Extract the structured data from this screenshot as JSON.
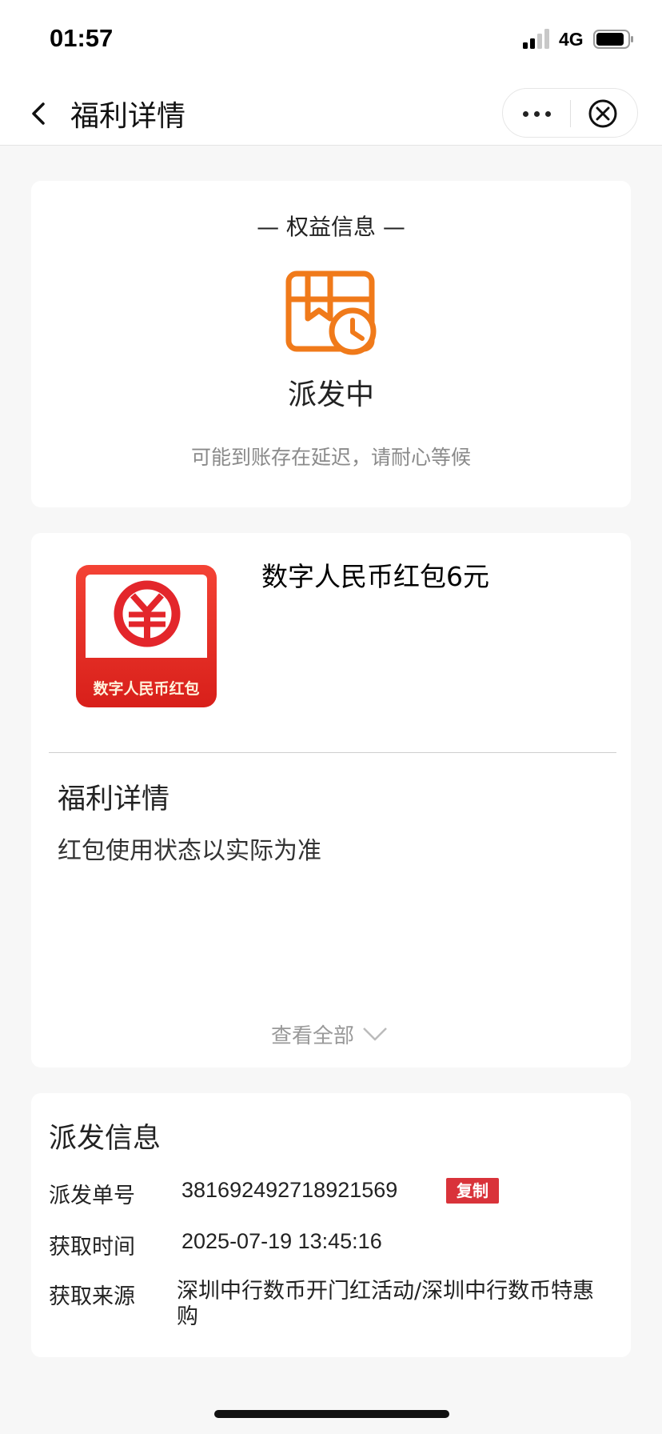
{
  "status_bar": {
    "time": "01:57",
    "network": "4G"
  },
  "nav": {
    "title": "福利详情"
  },
  "benefit_info": {
    "heading": "— 权益信息 —",
    "status": "派发中",
    "hint": "可能到账存在延迟，请耐心等候"
  },
  "product": {
    "image_label": "数字人民币红包",
    "name": "数字人民币红包6元",
    "detail_title": "福利详情",
    "detail_body": "红包使用状态以实际为准",
    "view_all": "查看全部"
  },
  "distribution": {
    "title": "派发信息",
    "order_label": "派发单号",
    "order_value": "381692492718921569",
    "copy_label": "复制",
    "time_label": "获取时间",
    "time_value": "2025-07-19 13:45:16",
    "source_label": "获取来源",
    "source_value": "深圳中行数币开门红活动/深圳中行数币特惠购"
  },
  "colors": {
    "accent_orange": "#f07a1a",
    "brand_red": "#d9333a"
  }
}
